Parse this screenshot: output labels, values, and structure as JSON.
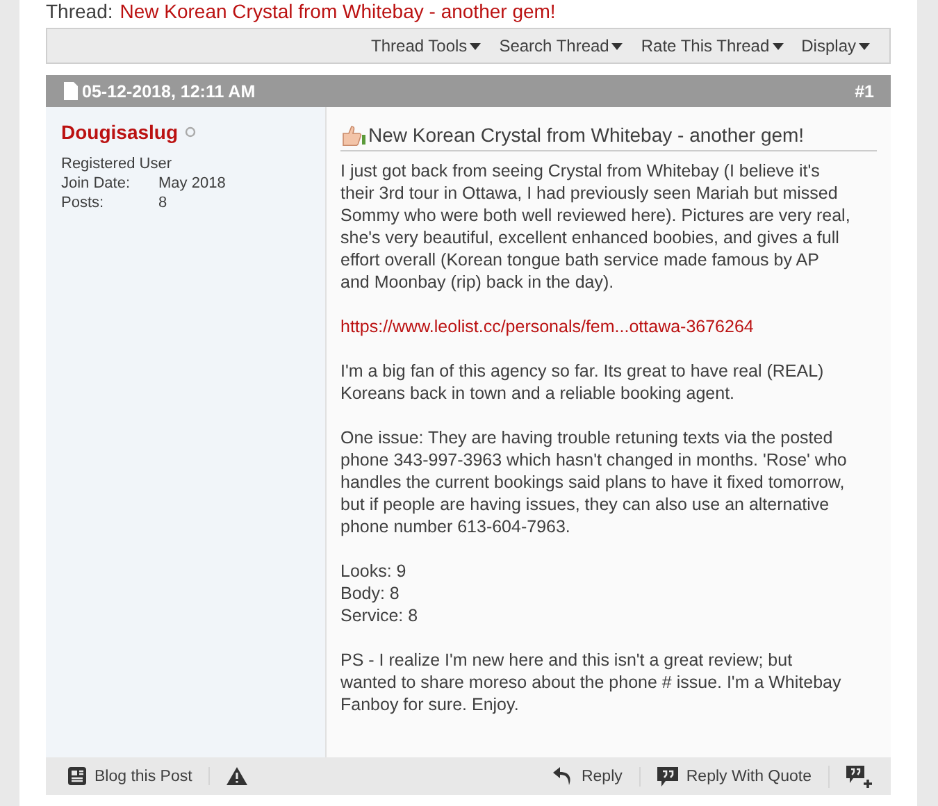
{
  "thread": {
    "label": "Thread:",
    "title": "New Korean Crystal from Whitebay - another gem!"
  },
  "toolbar": [
    {
      "label": "Thread Tools"
    },
    {
      "label": "Search Thread"
    },
    {
      "label": "Rate This Thread"
    },
    {
      "label": "Display"
    }
  ],
  "post": {
    "date": "05-12-2018, 12:11 AM",
    "number": "#1",
    "user": {
      "name": "Dougisaslug",
      "online": false,
      "title": "Registered User",
      "stats": [
        {
          "label": "Join Date:",
          "value": "May 2018"
        },
        {
          "label": "Posts:",
          "value": "8"
        }
      ]
    },
    "title": "New Korean Crystal from Whitebay - another gem!",
    "body": [
      {
        "kind": "text",
        "text": "I just got back from seeing Crystal from Whitebay (I believe it's their 3rd tour in Ottawa, I had previously seen Mariah but missed Sommy who were both well reviewed here). Pictures are very real, she's very beautiful, excellent enhanced boobies, and gives a full effort overall (Korean tongue bath service made famous by AP and Moonbay (rip) back in the day)."
      },
      {
        "kind": "link",
        "text": "https://www.leolist.cc/personals/fem...ottawa-3676264"
      },
      {
        "kind": "text",
        "text": "I'm a big fan of this agency so far. Its great to have real (REAL) Koreans back in town and a reliable booking agent."
      },
      {
        "kind": "text",
        "text": "One issue: They are having trouble retuning texts via the posted phone 343-997-3963 which hasn't changed in months. 'Rose' who handles the current bookings said plans to have it fixed tomorrow, but if people are having issues, they can also use an alternative phone number 613-604-7963."
      },
      {
        "kind": "lines",
        "lines": [
          "Looks: 9",
          "Body: 8",
          "Service: 8"
        ]
      },
      {
        "kind": "text",
        "text": "PS - I realize I'm new here and this isn't a great review; but wanted to share moreso about the phone # issue. I'm a Whitebay Fanboy for sure. Enjoy."
      }
    ],
    "footer_left": [
      {
        "kind": "blog",
        "label": "Blog this Post"
      },
      {
        "kind": "report"
      }
    ],
    "footer_right": [
      {
        "kind": "reply",
        "label": "Reply"
      },
      {
        "kind": "quote",
        "label": "Reply With Quote"
      },
      {
        "kind": "multiquote"
      }
    ]
  }
}
